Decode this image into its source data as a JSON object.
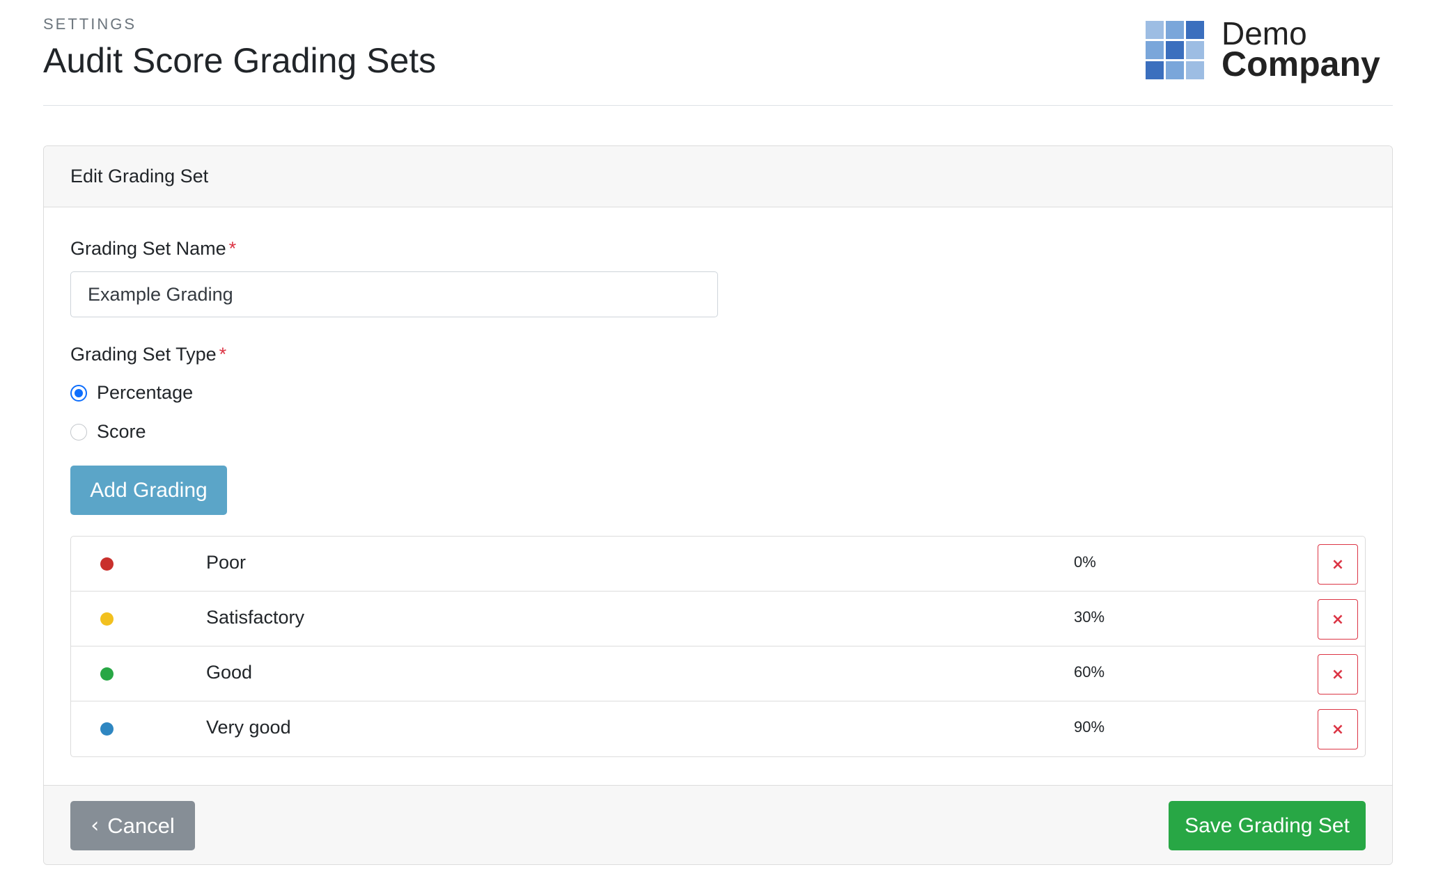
{
  "header": {
    "section": "SETTINGS",
    "title": "Audit Score Grading Sets"
  },
  "logo": {
    "line1": "Demo",
    "line2": "Company",
    "tile_colors": [
      "#9dbde3",
      "#7aa6da",
      "#3b6fbe",
      "#7aa6da",
      "#3b6fbe",
      "#9dbde3",
      "#3b6fbe",
      "#7aa6da",
      "#9dbde3"
    ]
  },
  "card": {
    "title": "Edit Grading Set"
  },
  "form": {
    "name_label": "Grading Set Name",
    "required_mark": "*",
    "name_value": "Example Grading",
    "type_label": "Grading Set Type",
    "type_options": [
      {
        "label": "Percentage",
        "checked": true
      },
      {
        "label": "Score",
        "checked": false
      }
    ],
    "add_button": "Add Grading"
  },
  "gradings": [
    {
      "name": "Poor",
      "value": "0%",
      "color": "#c9302c"
    },
    {
      "name": "Satisfactory",
      "value": "30%",
      "color": "#f2c01e"
    },
    {
      "name": "Good",
      "value": "60%",
      "color": "#28a745"
    },
    {
      "name": "Very good",
      "value": "90%",
      "color": "#2e86c1"
    }
  ],
  "remove_label": "×",
  "footer": {
    "cancel_icon": "‹",
    "cancel": "Cancel",
    "save": "Save Grading Set"
  }
}
